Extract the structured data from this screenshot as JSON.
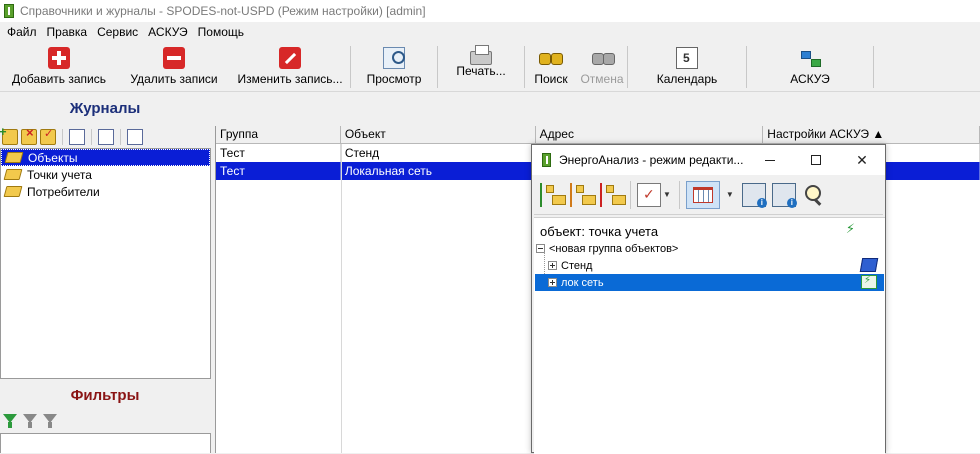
{
  "window": {
    "title": "Справочники и журналы - SPODES-not-USPD (Режим настройки) [admin]"
  },
  "menu": [
    "Файл",
    "Правка",
    "Сервис",
    "АСКУЭ",
    "Помощь"
  ],
  "toolbar": {
    "add": "Добавить запись",
    "delete": "Удалить записи",
    "edit": "Изменить запись...",
    "view": "Просмотр",
    "print": "Печать...",
    "search": "Поиск",
    "cancel": "Отмена",
    "calendar": "Календарь",
    "askue": "АСКУЭ"
  },
  "journals": {
    "header": "Журналы",
    "items": [
      "Объекты",
      "Точки учета",
      "Потребители"
    ],
    "selected_index": 0
  },
  "filters": {
    "header": "Фильтры"
  },
  "grid": {
    "columns": [
      "Группа",
      "Объект",
      "Адрес",
      "Настройки АСКУЭ ▲"
    ],
    "rows": [
      [
        "Тест",
        "Стенд",
        "",
        ""
      ],
      [
        "Тест",
        "Локальная сеть",
        "",
        ""
      ]
    ],
    "selected_row": 1
  },
  "dialog": {
    "title": "ЭнергоАнализ - режим редакти...",
    "object_label": "объект: точка учета",
    "tree": {
      "root": "<новая группа объектов>",
      "children": [
        "Стенд",
        "лок сеть"
      ],
      "selected_child": 1
    }
  }
}
